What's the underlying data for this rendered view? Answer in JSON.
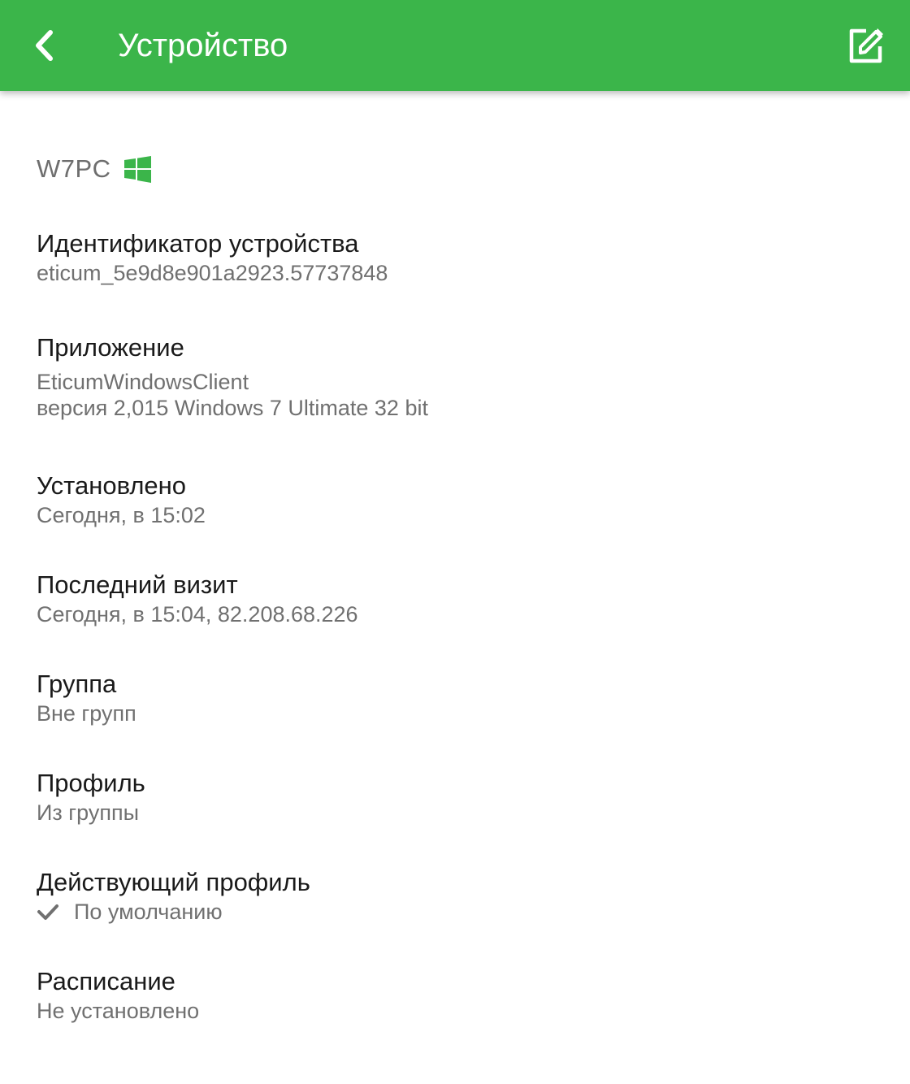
{
  "header": {
    "title": "Устройство",
    "back_icon": "chevron-left-icon",
    "edit_icon": "edit-icon",
    "color": "#3bb54a"
  },
  "device": {
    "name": "W7PC",
    "os_icon": "windows-logo-icon"
  },
  "fields": {
    "device_id": {
      "label": "Идентификатор устройства",
      "value": "eticum_5e9d8e901a2923.57737848"
    },
    "application": {
      "label": "Приложение",
      "value_line1": "EticumWindowsClient",
      "value_line2": "версия 2,015 Windows 7 Ultimate 32 bit"
    },
    "installed": {
      "label": "Установлено",
      "value": "Сегодня, в 15:02"
    },
    "last_visit": {
      "label": "Последний визит",
      "value": "Сегодня, в 15:04, 82.208.68.226"
    },
    "group": {
      "label": "Группа",
      "value": "Вне групп"
    },
    "profile": {
      "label": "Профиль",
      "value": "Из группы"
    },
    "active_profile": {
      "label": "Действующий профиль",
      "value": "По умолчанию",
      "icon": "check-icon"
    },
    "schedule": {
      "label": "Расписание",
      "value": "Не установлено"
    }
  }
}
